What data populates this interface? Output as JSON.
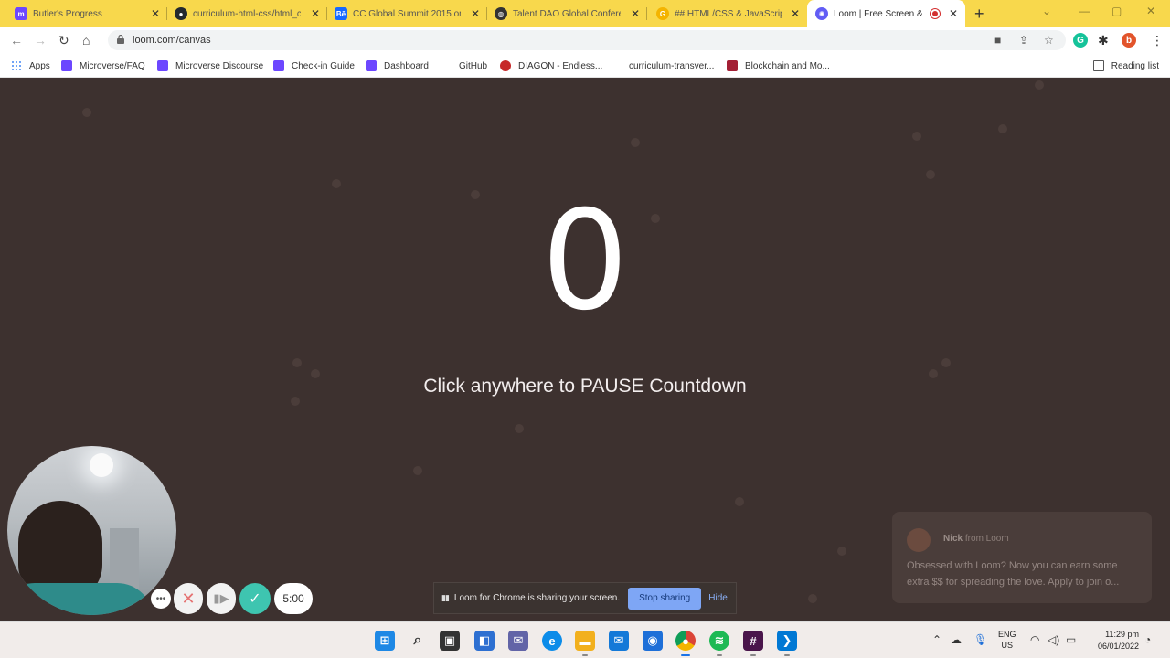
{
  "browser": {
    "tabs": [
      {
        "title": "Butler's Progress",
        "favicon": "microverse-icon",
        "color": "#6c47ff"
      },
      {
        "title": "curriculum-html-css/html_c",
        "favicon": "github-icon",
        "color": "#24292e"
      },
      {
        "title": "CC Global Summit 2015 on",
        "favicon": "behance-icon",
        "color": "#1769ff"
      },
      {
        "title": "Talent DAO Global Confere",
        "favicon": "globe-icon",
        "color": "#333333"
      },
      {
        "title": "## HTML/CSS & JavaScript",
        "favicon": "google-icon",
        "color": "#f4b400"
      },
      {
        "title": "Loom | Free Screen & V",
        "favicon": "loom-icon",
        "color": "#625df5",
        "active": true
      }
    ],
    "url": "loom.com/canvas",
    "bookmarks": [
      {
        "label": "Apps",
        "icon": "apps-grid-icon"
      },
      {
        "label": "Microverse/FAQ",
        "icon": "microverse-icon"
      },
      {
        "label": "Microverse Discourse",
        "icon": "microverse-icon"
      },
      {
        "label": "Check-in Guide",
        "icon": "microverse-icon"
      },
      {
        "label": "Dashboard",
        "icon": "microverse-icon"
      },
      {
        "label": "GitHub",
        "icon": "github-icon"
      },
      {
        "label": "DIAGON - Endless...",
        "icon": "diagon-icon"
      },
      {
        "label": "curriculum-transver...",
        "icon": "github-icon"
      },
      {
        "label": "Blockchain and Mo...",
        "icon": "mit-icon"
      }
    ],
    "reading_list": "Reading list",
    "profile_initial": "b"
  },
  "canvas": {
    "countdown": "0",
    "hint": "Click anywhere to PAUSE Countdown",
    "timer": "5:00",
    "notification": {
      "sender": "Nick",
      "sender_suffix": "from Loom",
      "message": "Obsessed with Loom? Now you can earn some extra $$ for spreading the love. Apply to join o..."
    },
    "share_banner": {
      "text": "Loom for Chrome is sharing your screen.",
      "stop_label": "Stop sharing",
      "hide_label": "Hide"
    }
  },
  "taskbar": {
    "apps": [
      "windows-start-icon",
      "search-icon",
      "task-view-icon",
      "widgets-icon",
      "teams-chat-icon",
      "edge-icon",
      "file-explorer-icon",
      "mail-icon",
      "vpn-icon",
      "chrome-icon",
      "spotify-icon",
      "slack-icon",
      "vscode-icon"
    ],
    "language": "ENG",
    "region": "US",
    "time": "11:29 pm",
    "date": "06/01/2022"
  }
}
